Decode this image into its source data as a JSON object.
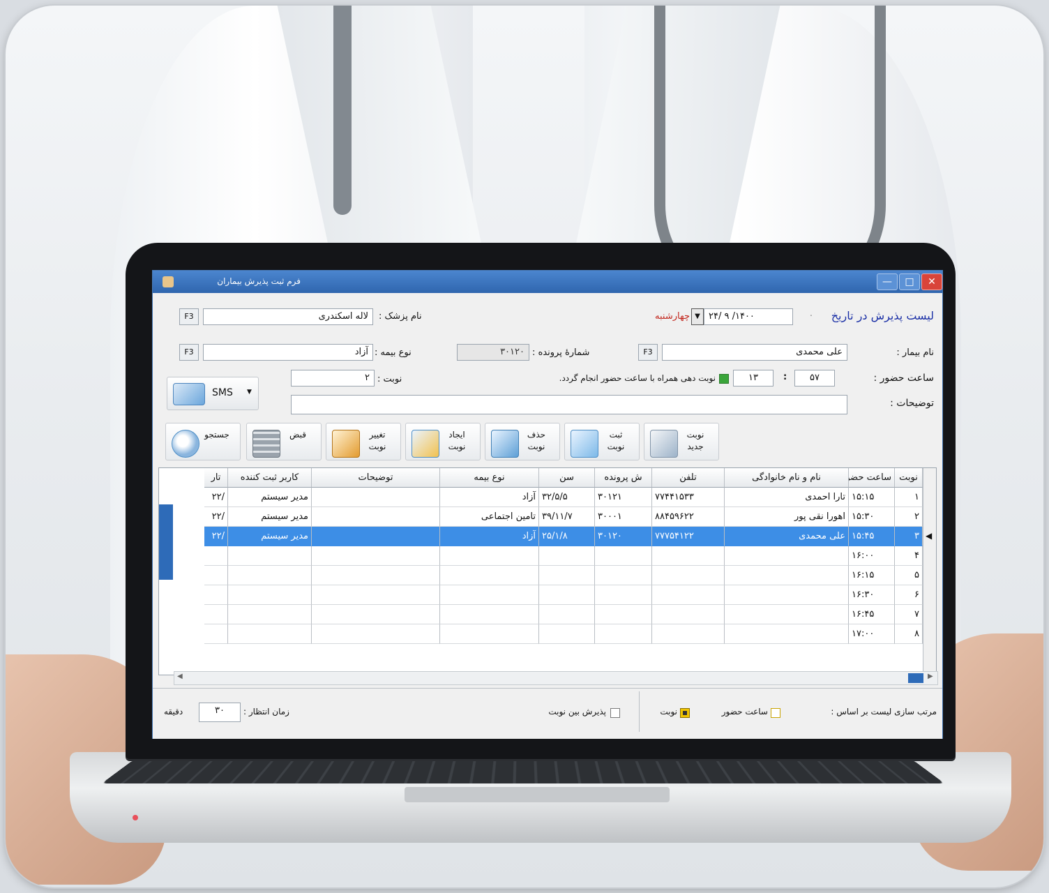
{
  "window": {
    "title": "فرم ثبت پذیرش بیماران"
  },
  "header": {
    "list_label": "لیست پذیرش در تاریخ",
    "date": "۱۴۰۰/ ۹ /۲۴",
    "weekday": "چهارشنبه",
    "doctor_label": "نام پزشک :",
    "doctor_name": "لاله اسکندری",
    "f3": "F3"
  },
  "form": {
    "patient_label": "نام بیمار :",
    "patient_name": "علی محمدی",
    "file_no_label": "شمارهٔ پرونده :",
    "file_no": "۳۰۱۲۰",
    "insurance_label": "نوع بیمه :",
    "insurance": "آزاد",
    "arrival_label": "ساعت حضور :",
    "arrival_min": "۵۷",
    "arrival_hour": "۱۳",
    "turn_with_time_label": "نوبت دهی همراه با ساعت حضور انجام گردد.",
    "turn_label": "نوبت :",
    "turn_value": "۲",
    "notes_label": "توضیحات :",
    "notes_value": "",
    "sms_label": "SMS"
  },
  "toolbar": {
    "new_turn": "نوبت جدید",
    "save_turn": "ثبت نوبت",
    "delete_turn": "حذف نوبت",
    "create_turn": "ایجاد نوبت",
    "change_turn": "تغییر نوبت",
    "receipt": "قبض",
    "search": "جستجو"
  },
  "grid": {
    "columns": [
      "نوبت",
      "ساعت حضور",
      "نام و نام خانوادگی",
      "تلفن",
      "ش پرونده",
      "سن",
      "نوع بیمه",
      "توضیحات",
      "کاربر ثبت کننده",
      "تار"
    ],
    "rows": [
      [
        "۱",
        "۱۵:۱۵",
        "تارا احمدی",
        "۷۷۴۴۱۵۳۳",
        "۳۰۱۲۱",
        "۳۲/۵/۵",
        "آزاد",
        "",
        "مدیر سیستم",
        "/۲۲"
      ],
      [
        "۲",
        "۱۵:۳۰",
        "اهورا نقی پور",
        "۸۸۴۵۹۶۲۲",
        "۳۰۰۰۱",
        "۳۹/۱۱/۷",
        "تامین اجتماعی",
        "",
        "مدیر سیستم",
        "/۲۲"
      ],
      [
        "۳",
        "۱۵:۴۵",
        "علی محمدی",
        "۷۷۷۵۴۱۲۲",
        "۳۰۱۲۰",
        "۲۵/۱/۸",
        "آزاد",
        "",
        "مدیر سیستم",
        "/۲۲"
      ],
      [
        "۴",
        "۱۶:۰۰",
        "",
        "",
        "",
        "",
        "",
        "",
        "",
        ""
      ],
      [
        "۵",
        "۱۶:۱۵",
        "",
        "",
        "",
        "",
        "",
        "",
        "",
        ""
      ],
      [
        "۶",
        "۱۶:۳۰",
        "",
        "",
        "",
        "",
        "",
        "",
        "",
        ""
      ],
      [
        "۷",
        "۱۶:۴۵",
        "",
        "",
        "",
        "",
        "",
        "",
        "",
        ""
      ],
      [
        "۸",
        "۱۷:۰۰",
        "",
        "",
        "",
        "",
        "",
        "",
        "",
        ""
      ]
    ],
    "selected_row": 3
  },
  "footer": {
    "sort_label": "مرتب سازی لیست بر اساس :",
    "sort_arrival": "ساعت حضور",
    "sort_turn": "نوبت",
    "between_turns": "پذیرش بین نوبت",
    "wait_label": "زمان انتظار :",
    "wait_value": "۳۰",
    "wait_unit": "دقیقه"
  },
  "colors": {
    "titlebar": "#2f66ae",
    "selection": "#3d8ee6",
    "accent_red": "#c2261d",
    "accent_blue": "#1a2fa6"
  },
  "icons": [
    "app-icon",
    "minimize-icon",
    "maximize-icon",
    "close-icon",
    "sms-icon",
    "new-turn-icon",
    "save-turn-icon",
    "delete-turn-icon",
    "create-turn-icon",
    "change-turn-icon",
    "calculator-icon",
    "search-icon"
  ]
}
